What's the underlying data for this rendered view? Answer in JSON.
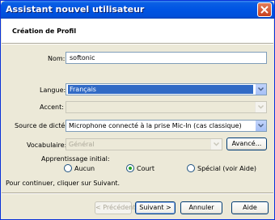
{
  "window": {
    "title": "Assistant nouvel utilisateur"
  },
  "header": {
    "title": "Création de Profil"
  },
  "form": {
    "name_label": "Nom:",
    "name_value": "softonic",
    "language_label": "Langue:",
    "language_value": "Français",
    "accent_label": "Accent:",
    "accent_value": "",
    "source_label": "Source de dictée:",
    "source_value": "Microphone connecté à la prise Mic-In (cas classique)",
    "vocab_label": "Vocabulaire:",
    "vocab_value": "Général",
    "advanced_button": "Avancé..."
  },
  "training": {
    "label": "Apprentissage initial:",
    "options": [
      "Aucun",
      "Court",
      "Spécial (voir Aide)"
    ],
    "selected": "Court"
  },
  "instruction": "Pour continuer, cliquer sur Suivant.",
  "footer": {
    "prev": "< Précédent",
    "next": "Suivant >",
    "cancel": "Annuler",
    "help": "Aide"
  },
  "colors": {
    "titlebar": "#0054e3",
    "selection": "#316ac5",
    "radio_dot": "#21a121"
  }
}
